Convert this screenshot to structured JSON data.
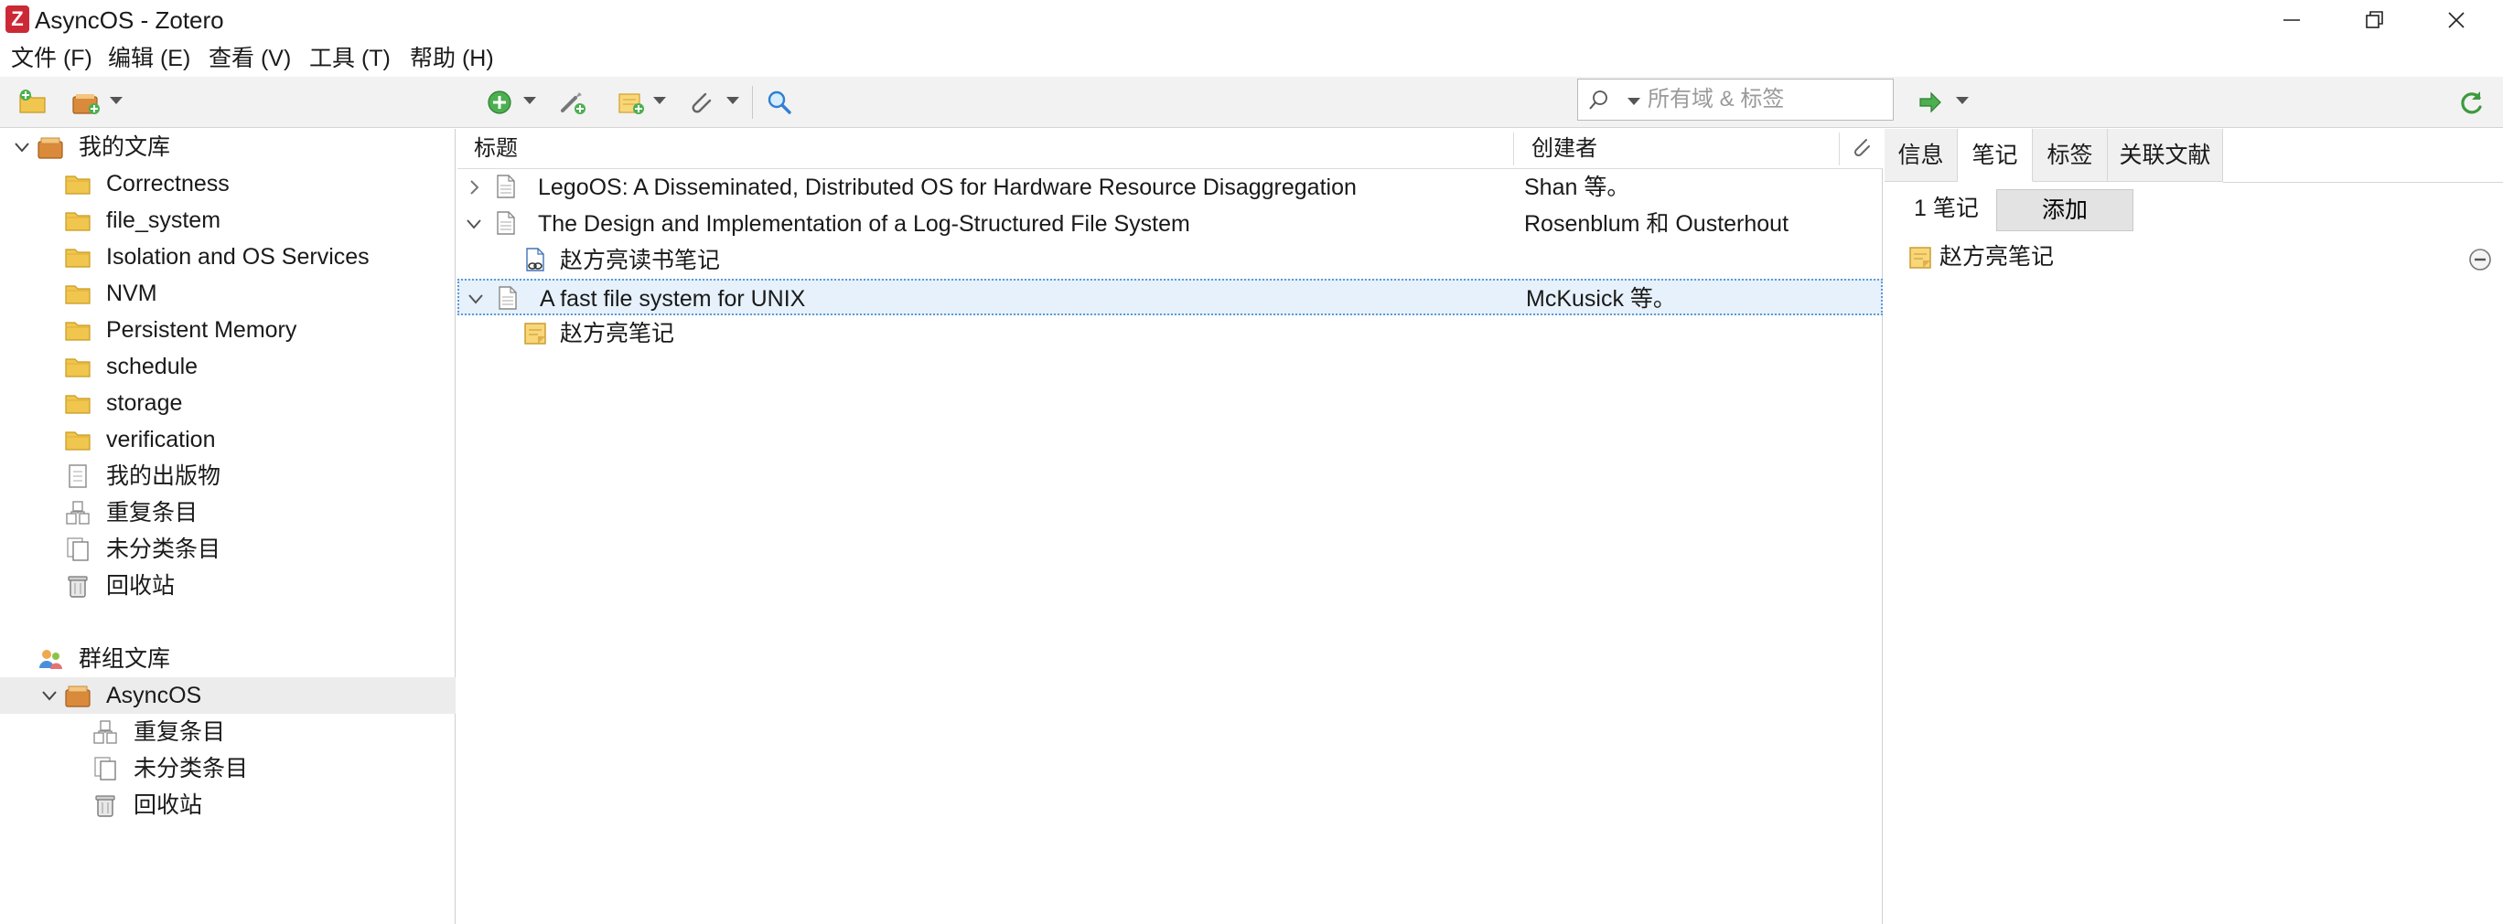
{
  "window": {
    "title": "AsyncOS - Zotero",
    "app_logo_letter": "Z",
    "controls": [
      "minimize-icon",
      "restore-icon",
      "close-icon"
    ]
  },
  "menubar": {
    "items": [
      "文件 (F)",
      "编辑 (E)",
      "查看 (V)",
      "工具 (T)",
      "帮助 (H)"
    ]
  },
  "toolbar": {
    "left_icons": [
      "new-collection-icon",
      "new-library-icon"
    ],
    "middle_icons": [
      "new-item-icon",
      "add-by-identifier-icon",
      "new-note-icon",
      "add-attachment-icon",
      "advanced-search-icon"
    ],
    "search": {
      "placeholder": "所有域 & 标签",
      "value": ""
    },
    "right_icons": [
      "locate-icon",
      "sync-icon"
    ]
  },
  "collections": {
    "my_library": {
      "label": "我的文库",
      "items": [
        {
          "label": "Correctness",
          "icon": "folder-icon"
        },
        {
          "label": "file_system",
          "icon": "folder-icon"
        },
        {
          "label": "Isolation and OS Services",
          "icon": "folder-icon"
        },
        {
          "label": "NVM",
          "icon": "folder-icon"
        },
        {
          "label": "Persistent Memory",
          "icon": "folder-icon"
        },
        {
          "label": "schedule",
          "icon": "folder-icon"
        },
        {
          "label": "storage",
          "icon": "folder-icon"
        },
        {
          "label": "verification",
          "icon": "folder-icon"
        },
        {
          "label": "我的出版物",
          "icon": "publications-icon"
        },
        {
          "label": "重复条目",
          "icon": "duplicates-icon"
        },
        {
          "label": "未分类条目",
          "icon": "unfiled-icon"
        },
        {
          "label": "回收站",
          "icon": "trash-icon"
        }
      ]
    },
    "group_libraries": {
      "label": "群组文库",
      "group": {
        "label": "AsyncOS",
        "items": [
          {
            "label": "重复条目",
            "icon": "duplicates-icon"
          },
          {
            "label": "未分类条目",
            "icon": "unfiled-icon"
          },
          {
            "label": "回收站",
            "icon": "trash-icon"
          }
        ]
      }
    }
  },
  "items_table": {
    "columns": {
      "title": "标题",
      "creator": "创建者"
    },
    "rows": [
      {
        "title": "LegoOS: A Disseminated, Distributed OS for Hardware Resource Disaggregation",
        "creator": "Shan 等。",
        "expanded": false
      },
      {
        "title": "The Design and Implementation of a Log-Structured File System",
        "creator": "Rosenblum 和 Ousterhout",
        "expanded": true
      },
      {
        "title": "赵方亮读书笔记",
        "creator": "",
        "child": true,
        "icon": "linked-file-icon"
      },
      {
        "title": "A fast file system for UNIX",
        "creator": "McKusick 等。",
        "expanded": true,
        "selected": true
      },
      {
        "title": "赵方亮笔记",
        "creator": "",
        "child": true,
        "icon": "note-icon"
      }
    ]
  },
  "item_pane": {
    "tabs": [
      "信息",
      "笔记",
      "标签",
      "关联文献"
    ],
    "active_tab": "笔记",
    "notes_count": "1 笔记",
    "add_label": "添加",
    "notes": [
      {
        "label": "赵方亮笔记"
      }
    ]
  },
  "colors": {
    "folder": "#f0c64f",
    "selected_row": "#e6f1fb",
    "selected_border": "#5a9bd5",
    "zotero_red": "#cc2936",
    "green_add": "#4caf50"
  }
}
